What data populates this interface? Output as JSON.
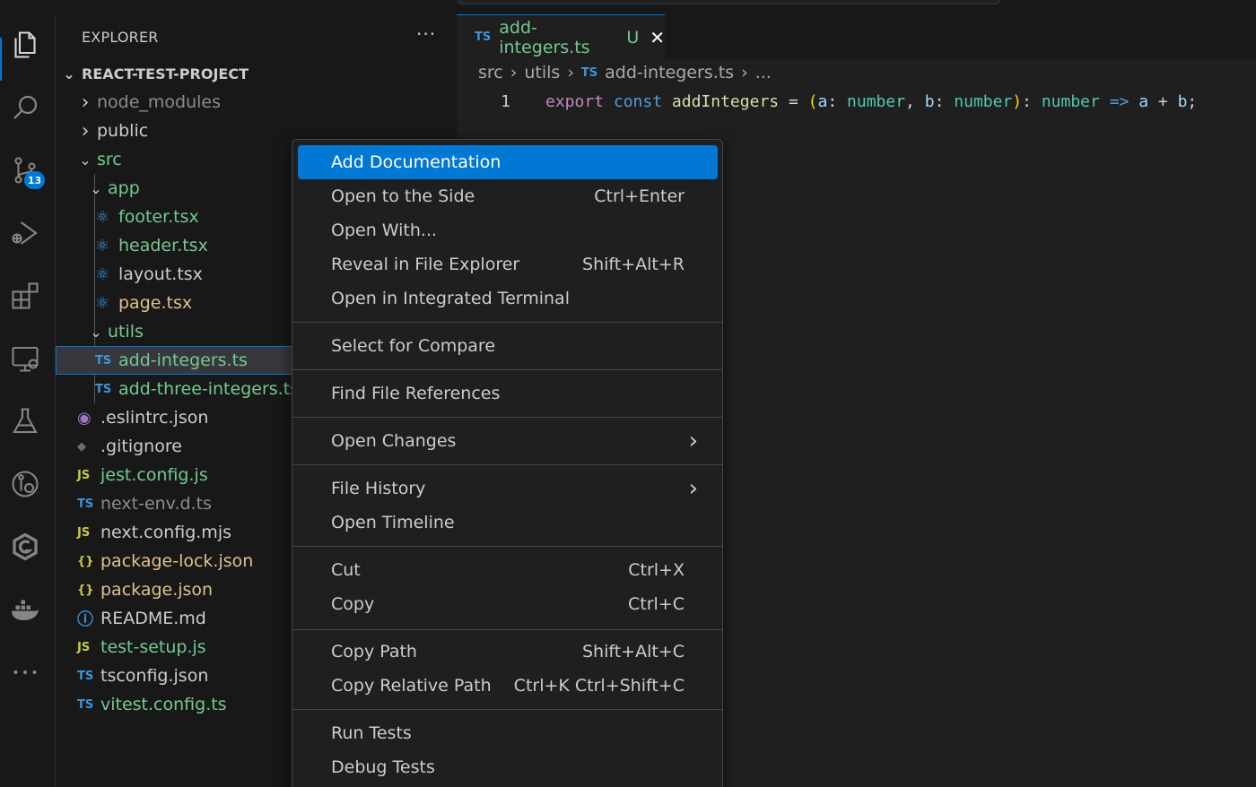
{
  "colors": {
    "accent": "#0078d4",
    "modified": "#73c991",
    "ts": "#3a96dd",
    "js": "#cbcb41",
    "json": "#cbcb41"
  },
  "activity_bar": {
    "items": [
      "files-icon",
      "search-icon",
      "source-control-icon",
      "run-debug-icon",
      "extensions-icon",
      "remote-explorer-icon",
      "testing-icon",
      "git-graph-icon",
      "gitlens-icon",
      "docker-icon",
      "more-icon"
    ],
    "source_control_badge": "13"
  },
  "explorer": {
    "title": "EXPLORER",
    "more": "···",
    "root": "REACT-TEST-PROJECT",
    "items": [
      {
        "label": "node_modules",
        "icon": "",
        "icon_name": "chevron-right-icon",
        "color": "#8c8c8c"
      },
      {
        "label": "public",
        "icon": "",
        "icon_name": "chevron-right-icon",
        "color": "#cccccc"
      },
      {
        "label": "src",
        "icon": "",
        "icon_name": "chevron-down-icon",
        "color": "#73c991"
      },
      {
        "label": "app",
        "icon": "",
        "icon_name": "chevron-down-icon",
        "color": "#73c991"
      },
      {
        "label": "footer.tsx",
        "icon": "⚛",
        "icon_name": "react-icon",
        "color": "#73c991"
      },
      {
        "label": "header.tsx",
        "icon": "⚛",
        "icon_name": "react-icon",
        "color": "#73c991"
      },
      {
        "label": "layout.tsx",
        "icon": "⚛",
        "icon_name": "react-icon",
        "color": "#cccccc"
      },
      {
        "label": "page.tsx",
        "icon": "⚛",
        "icon_name": "react-icon",
        "color": "#e2c08d"
      },
      {
        "label": "utils",
        "icon": "",
        "icon_name": "chevron-down-icon",
        "color": "#73c991"
      },
      {
        "label": "add-integers.ts",
        "icon": "TS",
        "icon_name": "typescript-icon",
        "color": "#73c991"
      },
      {
        "label": "add-three-integers.ts",
        "icon": "TS",
        "icon_name": "typescript-icon",
        "color": "#73c991"
      },
      {
        "label": ".eslintrc.json",
        "icon": "◉",
        "icon_name": "eslint-icon",
        "color": "#cccccc"
      },
      {
        "label": ".gitignore",
        "icon": "◆",
        "icon_name": "git-icon",
        "color": "#cccccc"
      },
      {
        "label": "jest.config.js",
        "icon": "JS",
        "icon_name": "javascript-icon",
        "color": "#73c991"
      },
      {
        "label": "next-env.d.ts",
        "icon": "TS",
        "icon_name": "typescript-icon",
        "color": "#8c8c8c"
      },
      {
        "label": "next.config.mjs",
        "icon": "JS",
        "icon_name": "javascript-icon",
        "color": "#cccccc"
      },
      {
        "label": "package-lock.json",
        "icon": "{}",
        "icon_name": "json-icon",
        "color": "#e2c08d"
      },
      {
        "label": "package.json",
        "icon": "{}",
        "icon_name": "json-icon",
        "color": "#e2c08d"
      },
      {
        "label": "README.md",
        "icon": "ⓘ",
        "icon_name": "info-icon",
        "color": "#cccccc"
      },
      {
        "label": "test-setup.js",
        "icon": "JS",
        "icon_name": "javascript-icon",
        "color": "#73c991"
      },
      {
        "label": "tsconfig.json",
        "icon": "TS",
        "icon_name": "tsconfig-icon",
        "color": "#cccccc"
      },
      {
        "label": "vitest.config.ts",
        "icon": "TS",
        "icon_name": "typescript-icon",
        "color": "#73c991"
      }
    ]
  },
  "editor": {
    "tab": {
      "badge": "TS",
      "name": "add-integers.ts",
      "status": "U",
      "close": "✕"
    },
    "breadcrumb": [
      "src",
      "utils",
      "add-integers.ts",
      "..."
    ],
    "breadcrumb_badge": "TS",
    "line_number": "1",
    "code": [
      "export",
      " ",
      "const",
      " ",
      "addIntegers",
      " = ",
      "(",
      "a",
      ": ",
      "number",
      ", ",
      "b",
      ": ",
      "number",
      ")",
      ": ",
      "number",
      " => ",
      "a",
      " + ",
      "b",
      ";"
    ]
  },
  "context_menu": {
    "items": [
      {
        "label": "Add Documentation",
        "shortcut": "",
        "active": true
      },
      {
        "label": "Open to the Side",
        "shortcut": "Ctrl+Enter"
      },
      {
        "label": "Open With...",
        "shortcut": ""
      },
      {
        "label": "Reveal in File Explorer",
        "shortcut": "Shift+Alt+R"
      },
      {
        "label": "Open in Integrated Terminal",
        "shortcut": ""
      },
      {
        "label": "Select for Compare",
        "shortcut": ""
      },
      {
        "label": "Find File References",
        "shortcut": ""
      },
      {
        "label": "Open Changes",
        "shortcut": "",
        "submenu": true
      },
      {
        "label": "File History",
        "shortcut": "",
        "submenu": true
      },
      {
        "label": "Open Timeline",
        "shortcut": ""
      },
      {
        "label": "Cut",
        "shortcut": "Ctrl+X"
      },
      {
        "label": "Copy",
        "shortcut": "Ctrl+C"
      },
      {
        "label": "Copy Path",
        "shortcut": "Shift+Alt+C"
      },
      {
        "label": "Copy Relative Path",
        "shortcut": "Ctrl+K Ctrl+Shift+C"
      },
      {
        "label": "Run Tests",
        "shortcut": ""
      },
      {
        "label": "Debug Tests",
        "shortcut": ""
      }
    ]
  }
}
